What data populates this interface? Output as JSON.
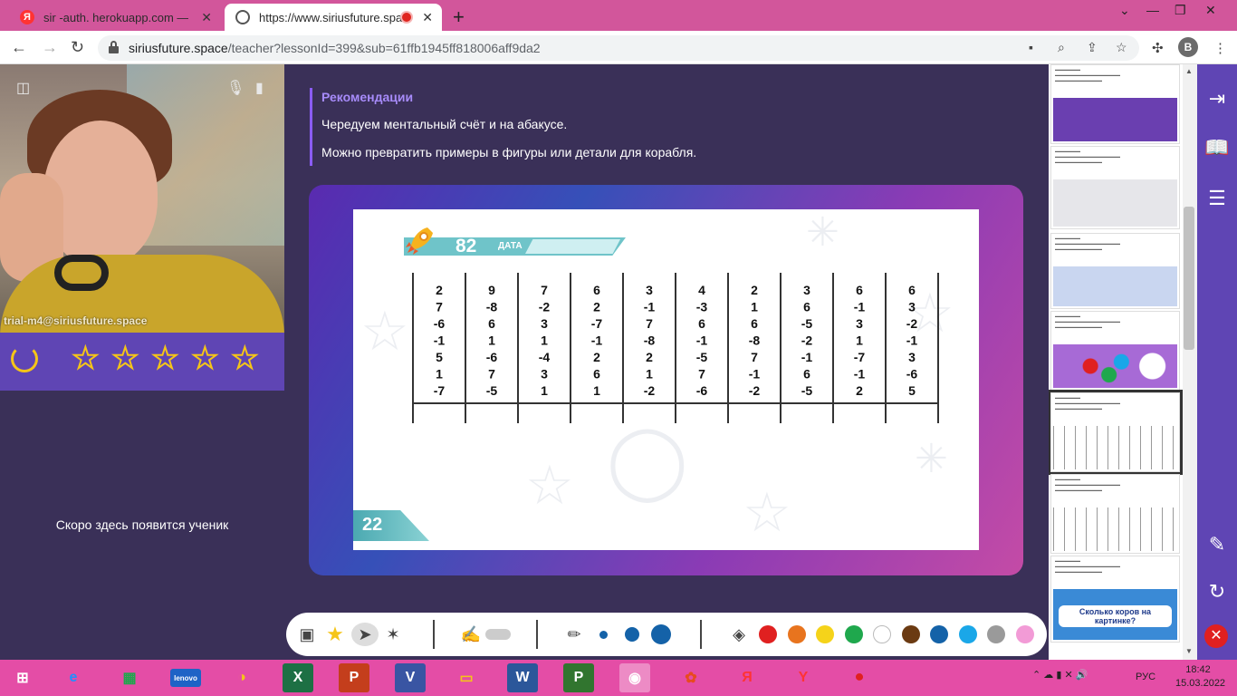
{
  "browser": {
    "tabs": [
      {
        "title": "sir -auth. herokuapp.com — Янде",
        "favicon": "yandex-icon",
        "active": false
      },
      {
        "title": "https://www.siriusfuture.space",
        "favicon": "globe-icon",
        "active": true,
        "recording": true
      }
    ],
    "url": {
      "host": "siriusfuture.space",
      "path": "/teacher?lessonId=399&sub=61ffb1945ff818006aff9da2"
    },
    "profile_initial": "B"
  },
  "video": {
    "participant": "trial-m4@siriusfuture.space"
  },
  "rating": {
    "max_stars": 5,
    "value": 0
  },
  "left_panel": {
    "waiting_text": "Скоро здесь появится ученик"
  },
  "recommendations": {
    "title": "Рекомендации",
    "lines": [
      "Чередуем ментальный счёт и на абакусе.",
      "Можно превратить примеры в фигуры или детали для корабля."
    ]
  },
  "slide": {
    "banner_number": "82",
    "banner_label": "ДАТА",
    "page_number": "22",
    "columns": [
      [
        "2",
        "7",
        "-6",
        "-1",
        "5",
        "1",
        "-7"
      ],
      [
        "9",
        "-8",
        "6",
        "1",
        "-6",
        "7",
        "-5"
      ],
      [
        "7",
        "-2",
        "3",
        "1",
        "-4",
        "3",
        "1"
      ],
      [
        "6",
        "2",
        "-7",
        "-1",
        "2",
        "6",
        "1"
      ],
      [
        "3",
        "-1",
        "7",
        "-8",
        "2",
        "1",
        "-2"
      ],
      [
        "4",
        "-3",
        "6",
        "-1",
        "-5",
        "7",
        "-6"
      ],
      [
        "2",
        "1",
        "6",
        "-8",
        "7",
        "-1",
        "-2"
      ],
      [
        "3",
        "6",
        "-5",
        "-2",
        "-1",
        "6",
        "-5"
      ],
      [
        "6",
        "-1",
        "3",
        "1",
        "-7",
        "-1",
        "2"
      ],
      [
        "6",
        "3",
        "-2",
        "-1",
        "3",
        "-6",
        "5"
      ]
    ]
  },
  "thumbnails": [
    {
      "kind": "space-dog",
      "color": "#6a3fb0"
    },
    {
      "kind": "marathon",
      "color": "#e6e6ea"
    },
    {
      "kind": "astronaut",
      "color": "#c9d6f0"
    },
    {
      "kind": "shapes",
      "color": "#a76ad6"
    },
    {
      "kind": "abacus-grid",
      "color": "#ffffff",
      "active": true
    },
    {
      "kind": "abacus-grid",
      "color": "#ffffff"
    },
    {
      "kind": "cows",
      "color": "#3a8ad6",
      "caption": "Сколько коров на картинке?"
    }
  ],
  "drawbar": {
    "colors": [
      "#e02020",
      "#e8741e",
      "#f5d31a",
      "#1fa84d",
      "#ffffff",
      "#6b3a12",
      "#1462a8",
      "#1aa7e8",
      "#9a9a9a",
      "#f29bd6"
    ],
    "brush_sizes": [
      "small",
      "medium",
      "large"
    ]
  },
  "taskbar": {
    "apps": [
      "start",
      "ie",
      "store",
      "lenovo",
      "audio",
      "excel",
      "powerpoint",
      "visio",
      "explorer",
      "word",
      "project",
      "chrome",
      "app-red",
      "yandex",
      "yandex-browser",
      "recorder"
    ],
    "lang": "РУС",
    "time": "18:42",
    "date": "15.03.2022"
  }
}
